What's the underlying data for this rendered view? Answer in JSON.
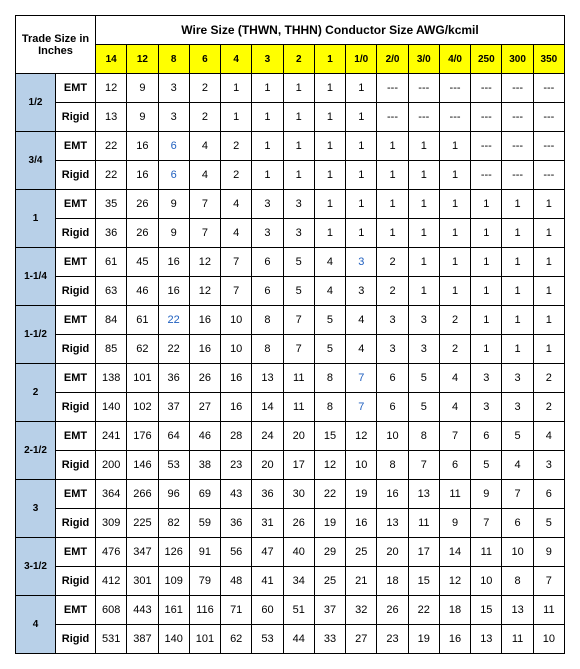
{
  "corner": "Trade Size in Inches",
  "wireHeader": "Wire Size (THWN, THHN) Conductor Size AWG/kcmil",
  "cols": [
    "14",
    "12",
    "8",
    "6",
    "4",
    "3",
    "2",
    "1",
    "1/0",
    "2/0",
    "3/0",
    "4/0",
    "250",
    "300",
    "350"
  ],
  "groups": [
    {
      "trade": "1/2",
      "rows": [
        {
          "type": "EMT",
          "vals": [
            "12",
            "9",
            "3",
            "2",
            "1",
            "1",
            "1",
            "1",
            "1",
            "---",
            "---",
            "---",
            "---",
            "---",
            "---"
          ]
        },
        {
          "type": "Rigid",
          "vals": [
            "13",
            "9",
            "3",
            "2",
            "1",
            "1",
            "1",
            "1",
            "1",
            "---",
            "---",
            "---",
            "---",
            "---",
            "---"
          ]
        }
      ]
    },
    {
      "trade": "3/4",
      "rows": [
        {
          "type": "EMT",
          "vals": [
            "22",
            "16",
            "6",
            "4",
            "2",
            "1",
            "1",
            "1",
            "1",
            "1",
            "1",
            "1",
            "---",
            "---",
            "---"
          ],
          "blue": [
            2
          ]
        },
        {
          "type": "Rigid",
          "vals": [
            "22",
            "16",
            "6",
            "4",
            "2",
            "1",
            "1",
            "1",
            "1",
            "1",
            "1",
            "1",
            "---",
            "---",
            "---"
          ],
          "blue": [
            2
          ]
        }
      ]
    },
    {
      "trade": "1",
      "rows": [
        {
          "type": "EMT",
          "vals": [
            "35",
            "26",
            "9",
            "7",
            "4",
            "3",
            "3",
            "1",
            "1",
            "1",
            "1",
            "1",
            "1",
            "1",
            "1"
          ]
        },
        {
          "type": "Rigid",
          "vals": [
            "36",
            "26",
            "9",
            "7",
            "4",
            "3",
            "3",
            "1",
            "1",
            "1",
            "1",
            "1",
            "1",
            "1",
            "1"
          ]
        }
      ]
    },
    {
      "trade": "1-1/4",
      "rows": [
        {
          "type": "EMT",
          "vals": [
            "61",
            "45",
            "16",
            "12",
            "7",
            "6",
            "5",
            "4",
            "3",
            "2",
            "1",
            "1",
            "1",
            "1",
            "1"
          ],
          "blue": [
            8
          ]
        },
        {
          "type": "Rigid",
          "vals": [
            "63",
            "46",
            "16",
            "12",
            "7",
            "6",
            "5",
            "4",
            "3",
            "2",
            "1",
            "1",
            "1",
            "1",
            "1"
          ]
        }
      ]
    },
    {
      "trade": "1-1/2",
      "rows": [
        {
          "type": "EMT",
          "vals": [
            "84",
            "61",
            "22",
            "16",
            "10",
            "8",
            "7",
            "5",
            "4",
            "3",
            "3",
            "2",
            "1",
            "1",
            "1"
          ],
          "blue": [
            2
          ]
        },
        {
          "type": "Rigid",
          "vals": [
            "85",
            "62",
            "22",
            "16",
            "10",
            "8",
            "7",
            "5",
            "4",
            "3",
            "3",
            "2",
            "1",
            "1",
            "1"
          ]
        }
      ]
    },
    {
      "trade": "2",
      "rows": [
        {
          "type": "EMT",
          "vals": [
            "138",
            "101",
            "36",
            "26",
            "16",
            "13",
            "11",
            "8",
            "7",
            "6",
            "5",
            "4",
            "3",
            "3",
            "2"
          ],
          "blue": [
            8
          ]
        },
        {
          "type": "Rigid",
          "vals": [
            "140",
            "102",
            "37",
            "27",
            "16",
            "14",
            "11",
            "8",
            "7",
            "6",
            "5",
            "4",
            "3",
            "3",
            "2"
          ],
          "blue": [
            8
          ]
        }
      ]
    },
    {
      "trade": "2-1/2",
      "rows": [
        {
          "type": "EMT",
          "vals": [
            "241",
            "176",
            "64",
            "46",
            "28",
            "24",
            "20",
            "15",
            "12",
            "10",
            "8",
            "7",
            "6",
            "5",
            "4"
          ]
        },
        {
          "type": "Rigid",
          "vals": [
            "200",
            "146",
            "53",
            "38",
            "23",
            "20",
            "17",
            "12",
            "10",
            "8",
            "7",
            "6",
            "5",
            "4",
            "3"
          ]
        }
      ]
    },
    {
      "trade": "3",
      "rows": [
        {
          "type": "EMT",
          "vals": [
            "364",
            "266",
            "96",
            "69",
            "43",
            "36",
            "30",
            "22",
            "19",
            "16",
            "13",
            "11",
            "9",
            "7",
            "6"
          ]
        },
        {
          "type": "Rigid",
          "vals": [
            "309",
            "225",
            "82",
            "59",
            "36",
            "31",
            "26",
            "19",
            "16",
            "13",
            "11",
            "9",
            "7",
            "6",
            "5"
          ]
        }
      ]
    },
    {
      "trade": "3-1/2",
      "rows": [
        {
          "type": "EMT",
          "vals": [
            "476",
            "347",
            "126",
            "91",
            "56",
            "47",
            "40",
            "29",
            "25",
            "20",
            "17",
            "14",
            "11",
            "10",
            "9"
          ]
        },
        {
          "type": "Rigid",
          "vals": [
            "412",
            "301",
            "109",
            "79",
            "48",
            "41",
            "34",
            "25",
            "21",
            "18",
            "15",
            "12",
            "10",
            "8",
            "7"
          ]
        }
      ]
    },
    {
      "trade": "4",
      "rows": [
        {
          "type": "EMT",
          "vals": [
            "608",
            "443",
            "161",
            "116",
            "71",
            "60",
            "51",
            "37",
            "32",
            "26",
            "22",
            "18",
            "15",
            "13",
            "11"
          ]
        },
        {
          "type": "Rigid",
          "vals": [
            "531",
            "387",
            "140",
            "101",
            "62",
            "53",
            "44",
            "33",
            "27",
            "23",
            "19",
            "16",
            "13",
            "11",
            "10"
          ]
        }
      ]
    }
  ]
}
